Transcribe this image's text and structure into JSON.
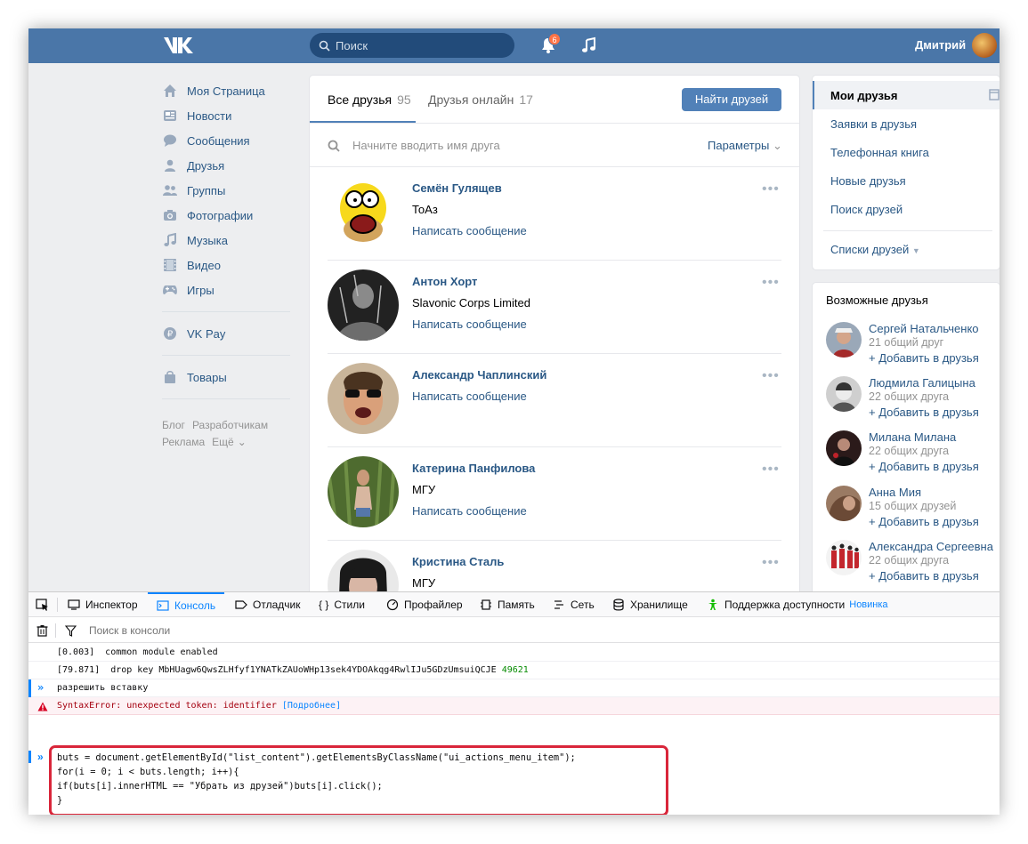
{
  "header": {
    "search_placeholder": "Поиск",
    "notif_count": "6",
    "user_name": "Дмитрий"
  },
  "left_nav": {
    "items": [
      {
        "label": "Моя Страница",
        "icon": "home-icon"
      },
      {
        "label": "Новости",
        "icon": "news-icon"
      },
      {
        "label": "Сообщения",
        "icon": "messages-icon"
      },
      {
        "label": "Друзья",
        "icon": "friends-icon"
      },
      {
        "label": "Группы",
        "icon": "groups-icon"
      },
      {
        "label": "Фотографии",
        "icon": "camera-icon"
      },
      {
        "label": "Музыка",
        "icon": "music-icon"
      },
      {
        "label": "Видео",
        "icon": "video-icon"
      },
      {
        "label": "Игры",
        "icon": "games-icon"
      }
    ],
    "vkpay": "VK Pay",
    "goods": "Товары",
    "footer": {
      "blog": "Блог",
      "dev": "Разработчикам",
      "ads": "Реклама",
      "more": "Ещё"
    }
  },
  "friends": {
    "tab_all": "Все друзья",
    "tab_all_count": "95",
    "tab_online": "Друзья онлайн",
    "tab_online_count": "17",
    "find_button": "Найти друзей",
    "search_placeholder": "Начните вводить имя друга",
    "params": "Параметры",
    "list": [
      {
        "name": "Семён Гулящев",
        "line2": "ТоАз",
        "action": "Написать сообщение"
      },
      {
        "name": "Антон Хорт",
        "line2": "Slavonic Corps Limited",
        "action": "Написать сообщение"
      },
      {
        "name": "Александр Чаплинский",
        "line2": "Написать сообщение",
        "action": ""
      },
      {
        "name": "Катерина Панфилова",
        "line2": "МГУ",
        "action": "Написать сообщение"
      },
      {
        "name": "Кристина Сталь",
        "line2": "МГУ",
        "action": ""
      }
    ]
  },
  "right_menu": {
    "items": [
      "Мои друзья",
      "Заявки в друзья",
      "Телефонная книга",
      "Новые друзья",
      "Поиск друзей"
    ],
    "lists": "Списки друзей"
  },
  "possible_friends": {
    "title": "Возможные друзья",
    "add_label": "+ Добавить в друзья",
    "list": [
      {
        "name": "Сергей Натальченко",
        "mutual": "21 общий друг"
      },
      {
        "name": "Людмила Галицына",
        "mutual": "22 общих друга"
      },
      {
        "name": "Милана Милана",
        "mutual": "22 общих друга"
      },
      {
        "name": "Анна Мия",
        "mutual": "15 общих друзей"
      },
      {
        "name": "Александра Сергеевна",
        "mutual": "22 общих друга"
      }
    ]
  },
  "devtools": {
    "tabs": [
      "Инспектор",
      "Консоль",
      "Отладчик",
      "Стили",
      "Профайлер",
      "Память",
      "Сеть",
      "Хранилище",
      "Поддержка доступности"
    ],
    "new_badge": "Новинка",
    "filter_placeholder": "Поиск в консоли",
    "log1": "[0.003]  common module enabled",
    "log2_text": "[79.871]  drop key MbHUagw6QwsZLHfyf1YNATkZAUoWHp13sek4YDOAkqg4RwlIJu5GDzUmsuiQCJE ",
    "log2_num": "49621",
    "input1": "разрешить вставку",
    "error_text": "SyntaxError: unexpected token: identifier ",
    "error_link": "[Подробнее]",
    "code": [
      "buts = document.getElementById(\"list_content\").getElementsByClassName(\"ui_actions_menu_item\");",
      "for(i = 0; i < buts.length; i++){",
      "if(buts[i].innerHTML == \"Убрать из друзей\")buts[i].click();",
      "}"
    ]
  },
  "colors": {
    "vk_blue": "#4a76a8",
    "link": "#2a5885",
    "highlight": "#d9263a"
  }
}
